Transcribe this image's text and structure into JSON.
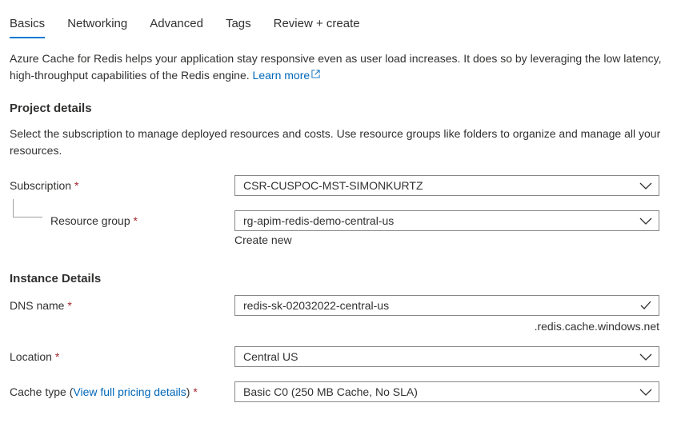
{
  "tabs": [
    {
      "label": "Basics",
      "active": true
    },
    {
      "label": "Networking"
    },
    {
      "label": "Advanced"
    },
    {
      "label": "Tags"
    },
    {
      "label": "Review + create"
    }
  ],
  "intro": {
    "text": "Azure Cache for Redis helps your application stay responsive even as user load increases. It does so by leveraging the low latency, high-throughput capabilities of the Redis engine.",
    "link": "Learn more"
  },
  "project_details": {
    "heading": "Project details",
    "description": "Select the subscription to manage deployed resources and costs. Use resource groups like folders to organize and manage all your resources.",
    "subscription_label": "Subscription",
    "subscription_value": "CSR-CUSPOC-MST-SIMONKURTZ",
    "resource_group_label": "Resource group",
    "resource_group_value": "rg-apim-redis-demo-central-us",
    "create_new": "Create new"
  },
  "instance_details": {
    "heading": "Instance Details",
    "dns_label": "DNS name",
    "dns_value": "redis-sk-02032022-central-us",
    "dns_suffix": ".redis.cache.windows.net",
    "location_label": "Location",
    "location_value": "Central US",
    "cache_type_label_prefix": "Cache type (",
    "cache_type_link": "View full pricing details",
    "cache_type_label_suffix": ")",
    "cache_type_value": "Basic C0 (250 MB Cache, No SLA)"
  },
  "required_marker": "*",
  "colors": {
    "accent": "#0078d4",
    "link": "#0067b8",
    "required": "#a4262c",
    "border": "#8a8886"
  },
  "icons": {
    "dropdown": "chevron-down-icon",
    "valid": "checkmark-icon",
    "external": "external-link-icon"
  }
}
